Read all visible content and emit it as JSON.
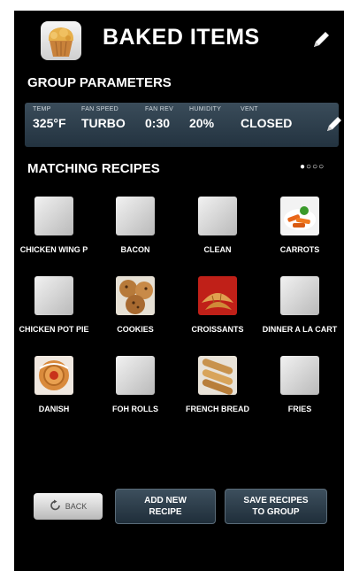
{
  "header": {
    "title": "BAKED ITEMS",
    "icon": "muffin-icon",
    "edit_icon": "pencil-icon"
  },
  "group_parameters": {
    "label": "GROUP PARAMETERS",
    "params": [
      {
        "label": "TEMP",
        "value": "325°F"
      },
      {
        "label": "FAN SPEED",
        "value": "TURBO"
      },
      {
        "label": "FAN REV",
        "value": "0:30"
      },
      {
        "label": "HUMIDITY",
        "value": "20%"
      },
      {
        "label": "VENT",
        "value": "CLOSED"
      }
    ],
    "edit_icon": "pencil-icon"
  },
  "matching_recipes": {
    "label": "MATCHING RECIPES",
    "pagination": "●○○○",
    "recipes": [
      {
        "label": "CHICKEN WING P",
        "image": "placeholder"
      },
      {
        "label": "BACON",
        "image": "placeholder"
      },
      {
        "label": "CLEAN",
        "image": "placeholder"
      },
      {
        "label": "CARROTS",
        "image": "carrots-photo"
      },
      {
        "label": "CHICKEN POT PIE",
        "image": "placeholder"
      },
      {
        "label": "COOKIES",
        "image": "cookies-photo"
      },
      {
        "label": "CROISSANTS",
        "image": "croissants-photo"
      },
      {
        "label": "DINNER A LA CART",
        "image": "placeholder"
      },
      {
        "label": "DANISH",
        "image": "danish-photo"
      },
      {
        "label": "FOH ROLLS",
        "image": "placeholder"
      },
      {
        "label": "FRENCH BREAD",
        "image": "french-bread-photo"
      },
      {
        "label": "FRIES",
        "image": "placeholder"
      }
    ]
  },
  "buttons": {
    "back": "BACK",
    "add_new_recipe": [
      "ADD NEW",
      "RECIPE"
    ],
    "save_recipes": [
      "SAVE RECIPES",
      "TO GROUP"
    ]
  }
}
